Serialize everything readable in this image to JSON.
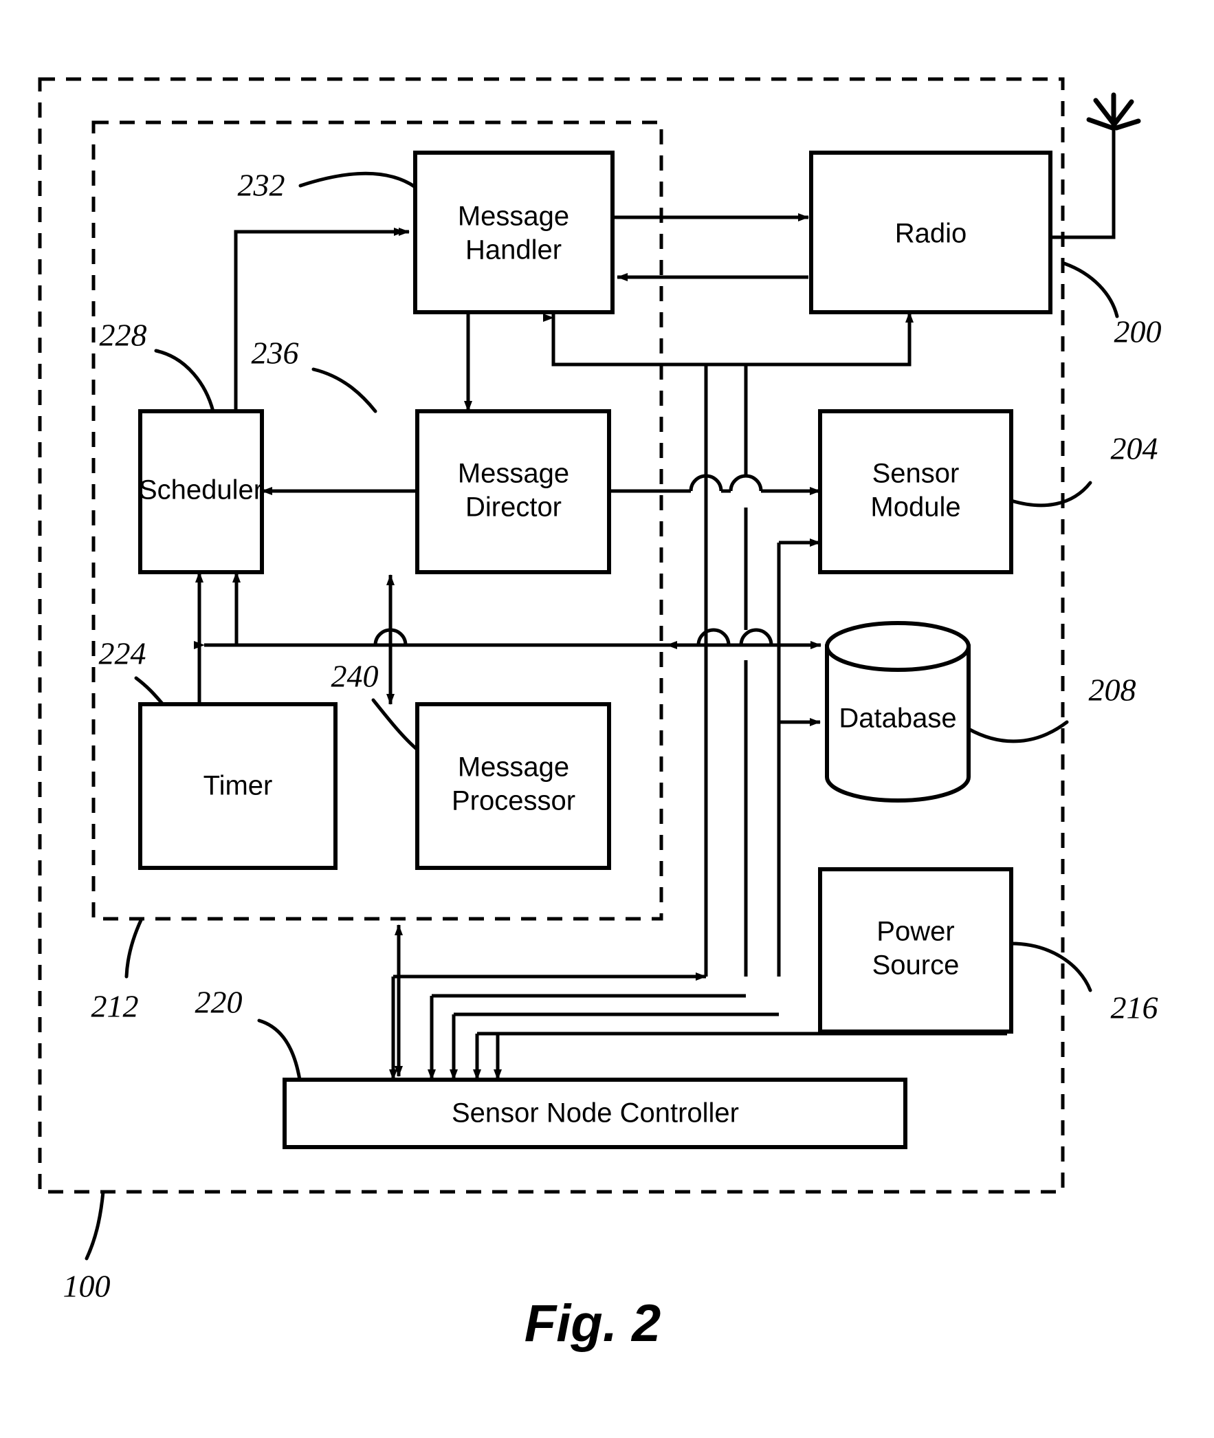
{
  "figure": {
    "caption": "Fig. 2",
    "title_ref": "100"
  },
  "outer_frame": {
    "name": "sensor-node-boundary",
    "ref": "100"
  },
  "inner_frame": {
    "name": "processor-boundary",
    "ref": "212"
  },
  "blocks": {
    "message_handler": {
      "label_line1": "Message",
      "label_line2": "Handler",
      "ref": "232"
    },
    "radio": {
      "label_line1": "Radio",
      "label_line2": "",
      "ref": "200"
    },
    "scheduler": {
      "label_line1": "Scheduler",
      "label_line2": "",
      "ref": "228"
    },
    "message_director": {
      "label_line1": "Message",
      "label_line2": "Director",
      "ref": "236"
    },
    "sensor_module": {
      "label_line1": "Sensor",
      "label_line2": "Module",
      "ref": "204"
    },
    "timer": {
      "label_line1": "Timer",
      "label_line2": "",
      "ref": "224"
    },
    "message_processor": {
      "label_line1": "Message",
      "label_line2": "Processor",
      "ref": "240"
    },
    "database": {
      "label_line1": "Database",
      "label_line2": "",
      "ref": "208"
    },
    "power_source": {
      "label_line1": "Power",
      "label_line2": "Source",
      "ref": "216"
    },
    "sensor_node_controller": {
      "label_line1": "Sensor Node Controller",
      "label_line2": "",
      "ref": "220"
    }
  },
  "reference_numerals": {
    "r100": "100",
    "r200": "200",
    "r204": "204",
    "r208": "208",
    "r212": "212",
    "r216": "216",
    "r220": "220",
    "r224": "224",
    "r228": "228",
    "r232": "232",
    "r236": "236",
    "r240": "240"
  },
  "icons": {
    "antenna": "antenna-icon"
  },
  "colors": {
    "ink": "#000000",
    "paper": "#ffffff"
  }
}
